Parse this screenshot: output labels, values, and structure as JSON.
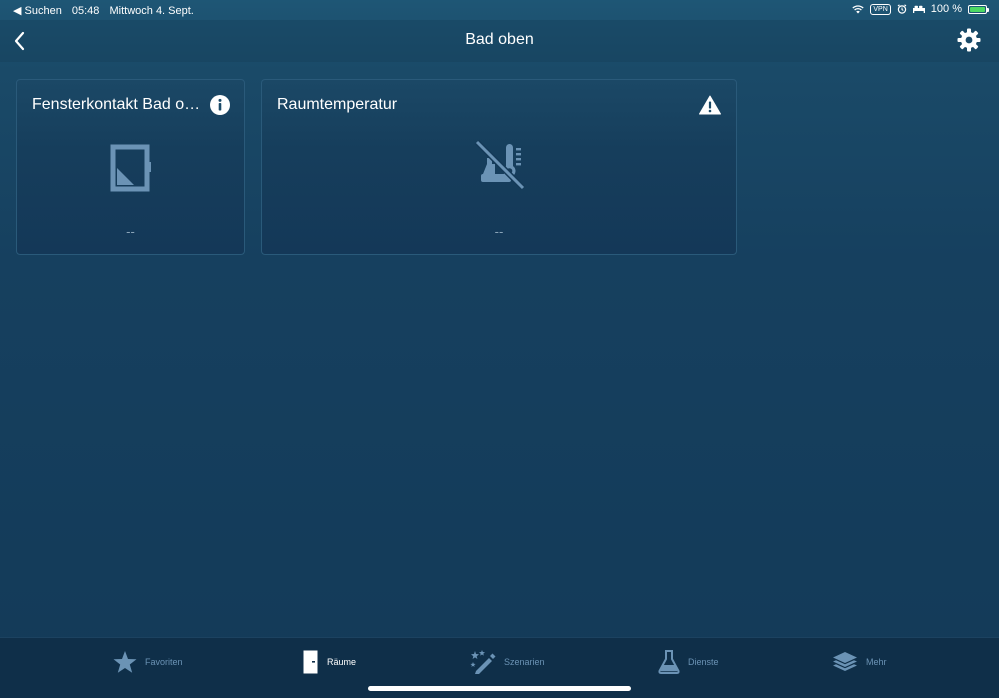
{
  "status_bar": {
    "back_app": "◀ Suchen",
    "time": "05:48",
    "date": "Mittwoch 4. Sept.",
    "vpn": "VPN",
    "battery_percent": "100 %",
    "battery_level": 100
  },
  "navbar": {
    "title": "Bad oben"
  },
  "tiles": [
    {
      "title": "Fensterkontakt Bad oben",
      "value": "--",
      "badge_icon": "info-icon",
      "device_icon": "window-contact-icon"
    },
    {
      "title": "Raumtemperatur",
      "value": "--",
      "badge_icon": "warning-icon",
      "device_icon": "thermostat-unavailable-icon"
    }
  ],
  "tabbar": {
    "items": [
      {
        "label": "Favoriten",
        "icon": "star-icon",
        "active": false
      },
      {
        "label": "Räume",
        "icon": "door-icon",
        "active": true
      },
      {
        "label": "Szenarien",
        "icon": "magic-wand-icon",
        "active": false
      },
      {
        "label": "Dienste",
        "icon": "flask-icon",
        "active": false
      },
      {
        "label": "Mehr",
        "icon": "layers-icon",
        "active": false
      }
    ]
  },
  "colors": {
    "background": "#16405f",
    "tile_icon": "#6b93b5",
    "tab_inactive": "#6b93b5",
    "tab_active": "#ffffff",
    "battery": "#4cd964"
  }
}
